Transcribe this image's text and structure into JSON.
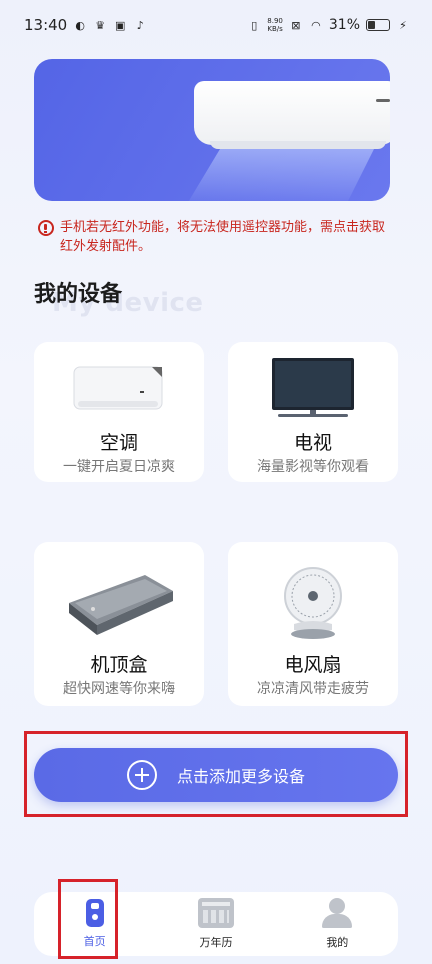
{
  "status_bar": {
    "time": "13:40",
    "speed": "8.90\nKB/s",
    "battery": "31%",
    "battery_level": 0.31
  },
  "warning": {
    "text": "手机若无红外功能，将无法使用遥控器功能，需点击获取红外发射配件。"
  },
  "section": {
    "title": "我的设备",
    "subtitle": "My device"
  },
  "devices": [
    {
      "name": "空调",
      "desc": "一键开启夏日凉爽"
    },
    {
      "name": "电视",
      "desc": "海量影视等你观看"
    },
    {
      "name": "机顶盒",
      "desc": "超快网速等你来嗨"
    },
    {
      "name": "电风扇",
      "desc": "凉凉清风带走疲劳"
    }
  ],
  "add_button": {
    "label": "点击添加更多设备"
  },
  "nav": [
    {
      "label": "首页",
      "icon": "remote-icon",
      "active": true
    },
    {
      "label": "万年历",
      "icon": "calendar-icon",
      "active": false
    },
    {
      "label": "我的",
      "icon": "user-icon",
      "active": false
    }
  ],
  "colors": {
    "accent": "#5a6ae6",
    "warning": "#c8261e",
    "highlight": "#d6222a"
  }
}
